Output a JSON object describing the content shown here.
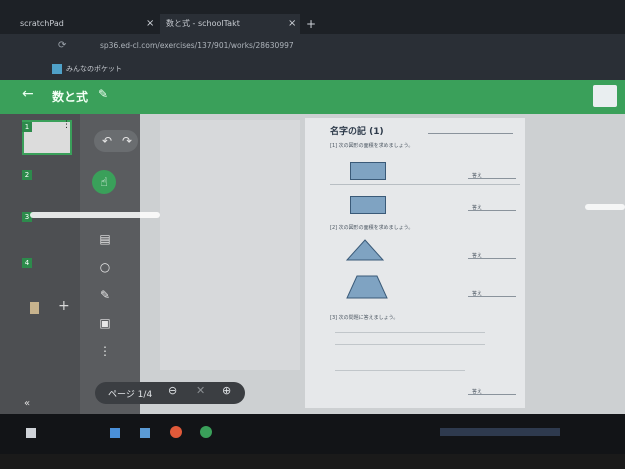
{
  "browser": {
    "tabs": [
      {
        "label": "scratchPad",
        "active": false
      },
      {
        "label": "数と式 - schoolTakt",
        "active": true
      }
    ],
    "new_tab": "+",
    "tab_close": "×",
    "address": "sp36.ed-cl.com/exercises/137/901/works/28630997",
    "bookmark": "みんなのポケット"
  },
  "app": {
    "title": "数と式",
    "edit_icon": "pencil-icon",
    "back_icon": "arrow-left-icon",
    "accent": "#3aa05a"
  },
  "pages": [
    "1",
    "2",
    "3",
    "4"
  ],
  "worksheet": {
    "title": "名字の記 (1)",
    "q1": "[1] 次の図形の面積を求めましょう。",
    "q2": "[2] 次の図形の面積を求めましょう。",
    "q3": "[3] 次の問題に答えましょう。",
    "answer_label": "答え"
  },
  "pager": {
    "label": "ページ 1/4"
  }
}
